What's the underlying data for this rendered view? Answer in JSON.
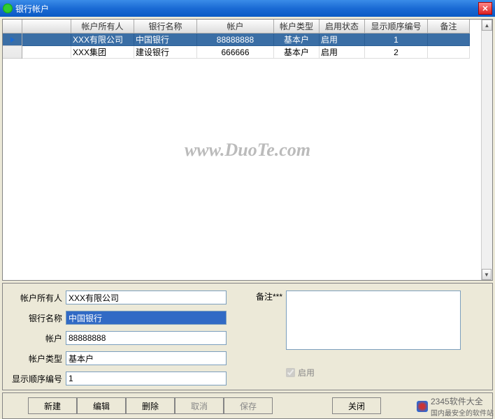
{
  "window": {
    "title": "银行帐户"
  },
  "grid": {
    "headers": [
      "帐户所有人",
      "银行名称",
      "帐户",
      "帐户类型",
      "启用状态",
      "显示顺序编号",
      "备注"
    ],
    "rows": [
      {
        "owner": "XXX有限公司",
        "bank": "中国银行",
        "account": "88888888",
        "type": "基本户",
        "status": "启用",
        "order": "1",
        "remark": "",
        "selected": true
      },
      {
        "owner": "XXX集团",
        "bank": "建设银行",
        "account": "666666",
        "type": "基本户",
        "status": "启用",
        "order": "2",
        "remark": "",
        "selected": false
      }
    ]
  },
  "form": {
    "labels": {
      "owner": "帐户所有人",
      "bank": "银行名称",
      "account": "帐户",
      "type": "帐户类型",
      "order": "显示顺序编号",
      "remark": "备注***",
      "enabled": "启用"
    },
    "values": {
      "owner": "XXX有限公司",
      "bank": "中国银行",
      "account": "88888888",
      "type": "基本户",
      "order": "1",
      "remark": "",
      "enabled": true
    }
  },
  "buttons": {
    "new": "新建",
    "edit": "编辑",
    "delete": "删除",
    "cancel": "取消",
    "save": "保存",
    "close": "关闭"
  },
  "watermark": "www.DuoTe.com",
  "footer": {
    "brand": "2345软件大全",
    "slogan": "国内最安全的软件站"
  }
}
